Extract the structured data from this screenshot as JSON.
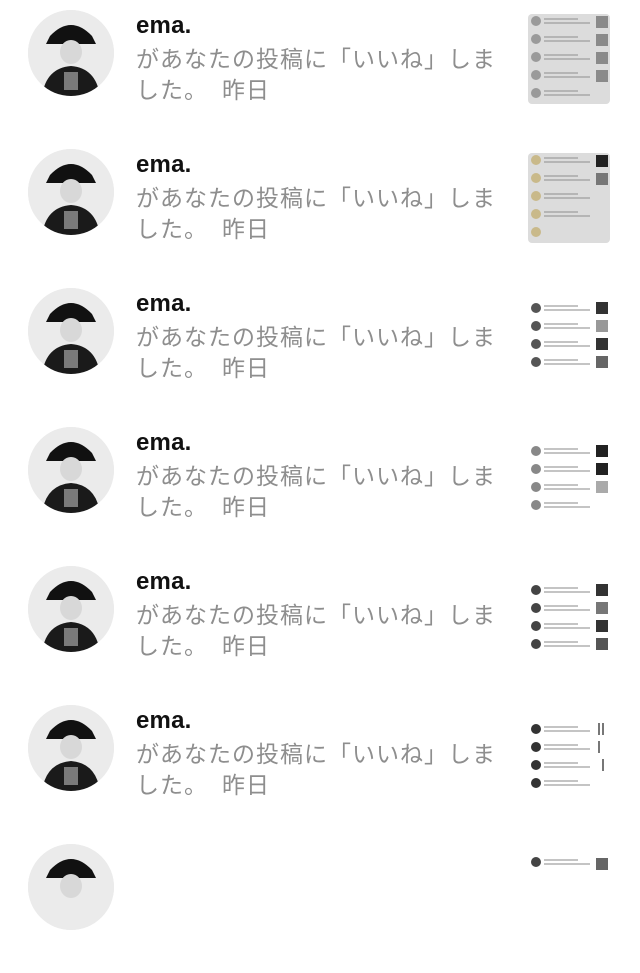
{
  "notifications": [
    {
      "username": "ema.",
      "message": "があなたの投稿に「いいね」しました。",
      "time": "昨日",
      "thumb_style": "gray"
    },
    {
      "username": "ema.",
      "message": "があなたの投稿に「いいね」しました。",
      "time": "昨日",
      "thumb_style": "gray"
    },
    {
      "username": "ema.",
      "message": "があなたの投稿に「いいね」しました。",
      "time": "昨日",
      "thumb_style": "white"
    },
    {
      "username": "ema.",
      "message": "があなたの投稿に「いいね」しました。",
      "time": "昨日",
      "thumb_style": "white"
    },
    {
      "username": "ema.",
      "message": "があなたの投稿に「いいね」しました。",
      "time": "昨日",
      "thumb_style": "white"
    },
    {
      "username": "ema.",
      "message": "があなたの投稿に「いいね」しました。",
      "time": "昨日",
      "thumb_style": "white"
    },
    {
      "username": "",
      "message": "",
      "time": "",
      "thumb_style": "white"
    }
  ]
}
